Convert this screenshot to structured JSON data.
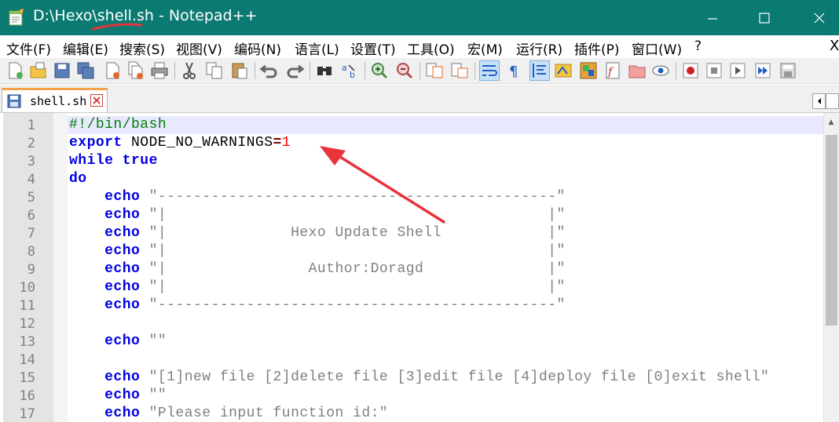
{
  "window": {
    "title": "D:\\Hexo\\shell.sh - Notepad++",
    "controls": {
      "minimize": "minimize-icon",
      "maximize": "maximize-icon",
      "close": "close-icon"
    }
  },
  "menu": {
    "items": [
      "文件(F)",
      "编辑(E)",
      "搜索(S)",
      "视图(V)",
      "编码(N)",
      "语言(L)",
      "设置(T)",
      "工具(O)",
      "宏(M)",
      "运行(R)",
      "插件(P)",
      "窗口(W)",
      "?"
    ],
    "close_doc": "X"
  },
  "toolbar": {
    "buttons": [
      "new-file-icon",
      "open-file-icon",
      "save-icon",
      "save-all-icon",
      "close-icon",
      "close-all-icon",
      "print-icon",
      "cut-icon",
      "copy-icon",
      "paste-icon",
      "undo-icon",
      "redo-icon",
      "find-icon",
      "replace-icon",
      "zoom-in-icon",
      "zoom-out-icon",
      "sync-vertical-icon",
      "sync-horizontal-icon",
      "word-wrap-icon",
      "show-all-chars-icon",
      "indent-guide-icon",
      "user-language-icon",
      "doc-map-icon",
      "function-list-icon",
      "folder-workspace-icon",
      "monitoring-icon",
      "record-macro-icon",
      "stop-macro-icon",
      "play-macro-icon",
      "run-macro-multiple-icon",
      "save-macro-icon"
    ]
  },
  "tabs": [
    {
      "label": "shell.sh",
      "icon": "save-icon",
      "active": true
    }
  ],
  "editor": {
    "lines": [
      {
        "n": "1",
        "tokens": [
          {
            "t": "#!/bin/bash",
            "c": "cmt"
          }
        ]
      },
      {
        "n": "2",
        "tokens": [
          {
            "t": "export",
            "c": "kw"
          },
          {
            "t": " NODE_NO_WARNINGS",
            "c": ""
          },
          {
            "t": "=",
            "c": "op"
          },
          {
            "t": "1",
            "c": "num"
          }
        ]
      },
      {
        "n": "3",
        "tokens": [
          {
            "t": "while",
            "c": "kw"
          },
          {
            "t": " ",
            "c": ""
          },
          {
            "t": "true",
            "c": "kw"
          }
        ]
      },
      {
        "n": "4",
        "tokens": [
          {
            "t": "do",
            "c": "kw"
          }
        ]
      },
      {
        "n": "5",
        "tokens": [
          {
            "t": "    ",
            "c": ""
          },
          {
            "t": "echo",
            "c": "kw"
          },
          {
            "t": " \"---------------------------------------------\"",
            "c": "str"
          }
        ]
      },
      {
        "n": "6",
        "tokens": [
          {
            "t": "    ",
            "c": ""
          },
          {
            "t": "echo",
            "c": "kw"
          },
          {
            "t": " \"|                                           |\"",
            "c": "str"
          }
        ]
      },
      {
        "n": "7",
        "tokens": [
          {
            "t": "    ",
            "c": ""
          },
          {
            "t": "echo",
            "c": "kw"
          },
          {
            "t": " \"|              Hexo Update Shell            |\"",
            "c": "str"
          }
        ]
      },
      {
        "n": "8",
        "tokens": [
          {
            "t": "    ",
            "c": ""
          },
          {
            "t": "echo",
            "c": "kw"
          },
          {
            "t": " \"|                                           |\"",
            "c": "str"
          }
        ]
      },
      {
        "n": "9",
        "tokens": [
          {
            "t": "    ",
            "c": ""
          },
          {
            "t": "echo",
            "c": "kw"
          },
          {
            "t": " \"|                Author:Doragd              |\"",
            "c": "str"
          }
        ]
      },
      {
        "n": "10",
        "tokens": [
          {
            "t": "    ",
            "c": ""
          },
          {
            "t": "echo",
            "c": "kw"
          },
          {
            "t": " \"|                                           |\"",
            "c": "str"
          }
        ]
      },
      {
        "n": "11",
        "tokens": [
          {
            "t": "    ",
            "c": ""
          },
          {
            "t": "echo",
            "c": "kw"
          },
          {
            "t": " \"---------------------------------------------\"",
            "c": "str"
          }
        ]
      },
      {
        "n": "12",
        "tokens": []
      },
      {
        "n": "13",
        "tokens": [
          {
            "t": "    ",
            "c": ""
          },
          {
            "t": "echo",
            "c": "kw"
          },
          {
            "t": " \"\"",
            "c": "str"
          }
        ]
      },
      {
        "n": "14",
        "tokens": []
      },
      {
        "n": "15",
        "tokens": [
          {
            "t": "    ",
            "c": ""
          },
          {
            "t": "echo",
            "c": "kw"
          },
          {
            "t": " \"[1]new file [2]delete file [3]edit file [4]deploy file [0]exit shell\"",
            "c": "str"
          }
        ]
      },
      {
        "n": "16",
        "tokens": [
          {
            "t": "    ",
            "c": ""
          },
          {
            "t": "echo",
            "c": "kw"
          },
          {
            "t": " \"\"",
            "c": "str"
          }
        ]
      },
      {
        "n": "17",
        "tokens": [
          {
            "t": "    ",
            "c": ""
          },
          {
            "t": "echo",
            "c": "kw"
          },
          {
            "t": " \"Please input function id:\"",
            "c": "str"
          }
        ]
      }
    ]
  },
  "colors": {
    "titlebar": "#0a7a72",
    "annotation": "#e8333a",
    "keyword": "#0000e0",
    "string": "#808080",
    "comment": "#008000",
    "number": "#ff0000"
  }
}
